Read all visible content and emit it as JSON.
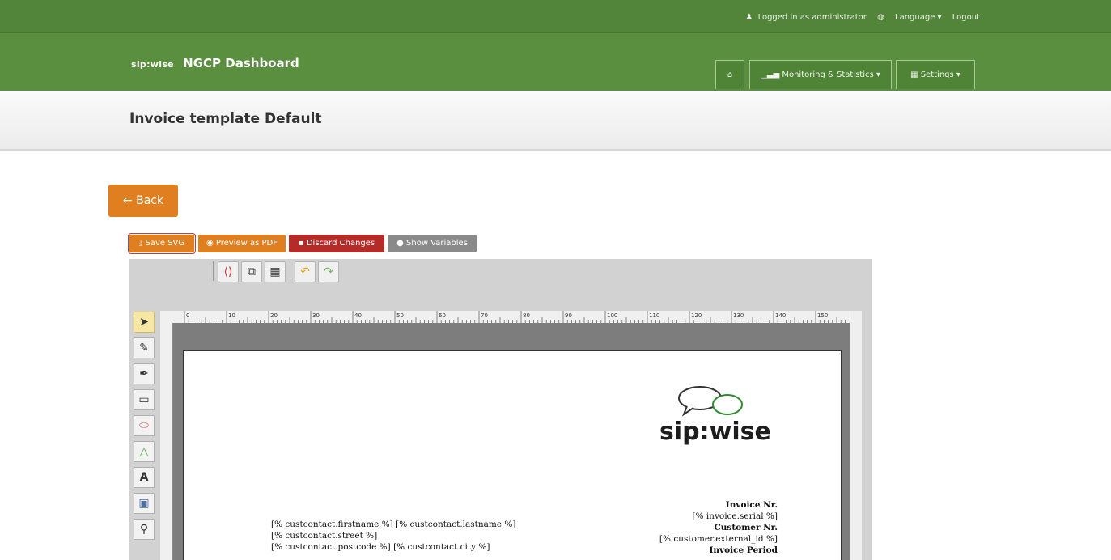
{
  "topbar": {
    "logged_in": "Logged in as administrator",
    "language": "Language",
    "logout": "Logout"
  },
  "navbar": {
    "brand": "NGCP Dashboard",
    "brand_logo": "sip:wise",
    "home_icon": "home-icon",
    "monitoring": "Monitoring & Statistics",
    "settings": "Settings"
  },
  "header": {
    "title": "Invoice template Default"
  },
  "back_label": "Back",
  "actions": {
    "save_svg": "Save SVG",
    "preview_pdf": "Preview as PDF",
    "discard": "Discard Changes",
    "show_vars": "Show Variables"
  },
  "editor": {
    "toolbar_icons": [
      "source-icon",
      "group-icon",
      "grid-icon",
      "undo-icon",
      "redo-icon"
    ],
    "left_tools": [
      "select-icon",
      "pencil-icon",
      "path-icon",
      "rect-icon",
      "ellipse-icon",
      "polygon-icon",
      "text-icon",
      "image-icon",
      "zoom-icon"
    ],
    "ruler_ticks": [
      "0",
      "10",
      "20",
      "30",
      "40",
      "50",
      "60",
      "70",
      "80",
      "90",
      "100",
      "110",
      "120",
      "130",
      "140",
      "150"
    ]
  },
  "invoice": {
    "logo_text": "sip:wise",
    "invoice_nr_label": "Invoice Nr.",
    "invoice_serial": "[% invoice.serial %]",
    "customer_nr_label": "Customer Nr.",
    "customer_external_id": "[% customer.external_id %]",
    "invoice_period_label": "Invoice Period",
    "cust_name": "[% custcontact.firstname %] [% custcontact.lastname %]",
    "cust_street": "[% custcontact.street %]",
    "cust_city": "[% custcontact.postcode %] [% custcontact.city %]"
  },
  "colors": {
    "green": "#5a8f3f",
    "orange": "#e07f1f",
    "red": "#b52b27",
    "gray": "#8a8a8a"
  }
}
